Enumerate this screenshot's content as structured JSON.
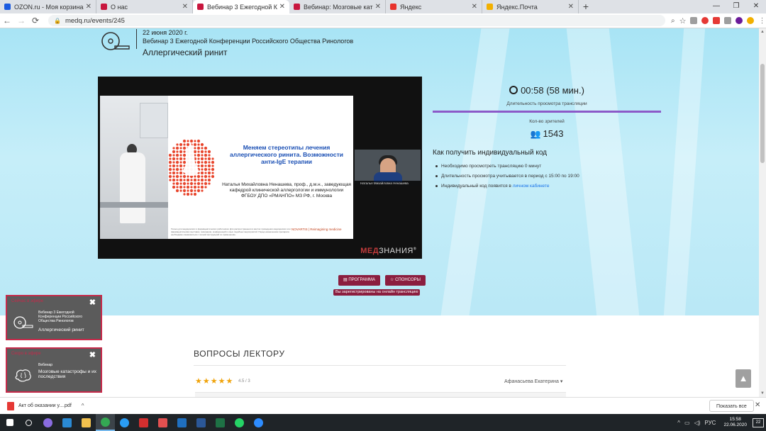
{
  "browser": {
    "tabs": [
      {
        "label": "OZON.ru - Моя корзина",
        "color": "#1a5ae0",
        "active": false
      },
      {
        "label": "О нас",
        "color": "#c8163e",
        "active": false
      },
      {
        "label": "Вебинар 3 Ежегодной Конфере…",
        "color": "#c8163e",
        "active": true
      },
      {
        "label": "Вебинар: Мозговые катастроф…",
        "color": "#c8163e",
        "active": false
      },
      {
        "label": "Яндекс",
        "color": "#e8322c",
        "active": false
      },
      {
        "label": "Яндекс.Почта",
        "color": "#f2b000",
        "active": false
      }
    ],
    "tab_close": "✕",
    "new_tab": "+",
    "url": "medq.ru/events/245",
    "window_controls": {
      "minimize": "—",
      "maximize": "❐",
      "close": "✕"
    }
  },
  "event": {
    "date": "22 июня 2020 г.",
    "name": "Вебинар 3 Ежегодной Конференции Российского Общества Ринологов",
    "title": "Аллергический ринит"
  },
  "video": {
    "slide_title": "Меняем стереотипы лечения аллергического ринита. Возможности анти-IgE терапии",
    "slide_author": "Наталья Михайловна Ненашева, проф., д.м.н., заведующая кафедрой клинической аллергологии и иммунологии ФГБОУ ДПО «РМАНПО» МЗ РФ, г. Москва",
    "slide_footer": "Только для медицинских и фармацевтических работников. Для распространения в местах проведения медицинских или фармацевтических выставок, семинаров, конференций и иных подобных мероприятий. Перед назначением препарата необходимо ознакомиться с полной инструкцией по применению.",
    "slide_logo": "NOVARTIS | Reimagining medicine",
    "camera_caption": "Наталья Михайловна Ненашева",
    "brand_a": "МЕД",
    "brand_b": "ЗНАНИЯ",
    "brand_mark": "®"
  },
  "stats": {
    "duration": "00:58 (58 мин.)",
    "duration_label": "Длительность просмотра трансляции",
    "viewers_label": "Кол-во зрителей",
    "viewers": "1543",
    "howto_title": "Как получить индивидуальный код",
    "steps": [
      "Необходимо просмотреть трансляцию 0 минут",
      "Длительность просмотра учитывается в период с 15:00 по 19:00"
    ],
    "step3_prefix": "Индивидуальный код появится в ",
    "step3_link": "личном кабинете"
  },
  "actions": {
    "program": "ПРОГРАММА",
    "sponsors": "СПОНСОРЫ",
    "registered": "Вы зарегистрированы на онлайн трансляцию"
  },
  "questions": {
    "title": "ВОПРОСЫ ЛЕКТОРУ",
    "stars": "★★★★★",
    "rating": "4.5 / 3",
    "author": "Афанасьева Екатерина ▾",
    "rating_fraction": 0.9
  },
  "notifications": [
    {
      "header": "Сейчас в эфире",
      "type": "Вебинар 3 Ежегодной Конференции Российского Общества Ринологов",
      "title": "Аллергический ринит"
    },
    {
      "header": "Скоро в эфире",
      "type": "Вебинар",
      "title": "Мозговые катастрофы и их последствия"
    }
  ],
  "scroll_top": "▲",
  "download": {
    "filename": "Акт об оказании у....pdf",
    "show_all": "Показать все",
    "chevron": "^",
    "close": "✕"
  },
  "taskbar": {
    "lang": "РУС",
    "time": "15:58",
    "date": "22.06.2020",
    "notif_count": "22",
    "icons": [
      {
        "name": "start",
        "color": "#ffffff"
      },
      {
        "name": "search",
        "color": "#ffffff"
      },
      {
        "name": "cortana",
        "color": "#8a6ce0"
      },
      {
        "name": "edge",
        "color": "#2a8ad4"
      },
      {
        "name": "explorer",
        "color": "#f2c14e"
      },
      {
        "name": "chrome",
        "color": "#34a853"
      },
      {
        "name": "skype",
        "color": "#2a9df4"
      },
      {
        "name": "acrobat",
        "color": "#d32f2f"
      },
      {
        "name": "pdf",
        "color": "#e35050"
      },
      {
        "name": "outlook",
        "color": "#1f6fbf"
      },
      {
        "name": "word",
        "color": "#2b5797"
      },
      {
        "name": "excel",
        "color": "#1e7145"
      },
      {
        "name": "whatsapp",
        "color": "#25d366"
      },
      {
        "name": "zoom",
        "color": "#2d8cff"
      }
    ]
  },
  "colors": {
    "accent": "#8b1e3f",
    "purple_line": "#8c5ac8",
    "hero_bg": "#b8e7f6",
    "link": "#1a73e8"
  }
}
